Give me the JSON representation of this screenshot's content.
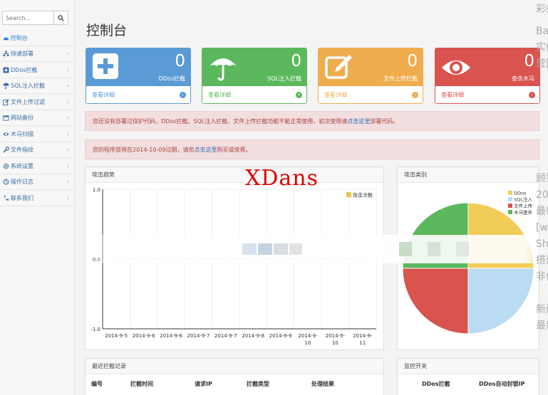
{
  "search": {
    "placeholder": "Search..."
  },
  "sidebar": {
    "items": [
      {
        "label": "控制台",
        "active": true
      },
      {
        "label": "快速部署",
        "chevron": "‹"
      },
      {
        "label": "DDos拦截",
        "chevron": "‹"
      },
      {
        "label": "SQL注入拦截",
        "chevron": "‹"
      },
      {
        "label": "文件上传过滤",
        "chevron": "‹"
      },
      {
        "label": "网站备份",
        "chevron": "‹"
      },
      {
        "label": "木马扫描",
        "chevron": "‹"
      },
      {
        "label": "文件指纹",
        "chevron": "‹"
      },
      {
        "label": "系统设置",
        "chevron": "‹"
      },
      {
        "label": "操作日志",
        "chevron": "‹"
      },
      {
        "label": "联系我们",
        "chevron": "‹"
      }
    ]
  },
  "page": {
    "title": "控制台"
  },
  "cards": [
    {
      "count": "0",
      "label": "DDos拦截",
      "link": "查看详细",
      "arrow": "›",
      "color": "#5a9bd5",
      "icon": "plus-icon"
    },
    {
      "count": "0",
      "label": "SQL注入拦截",
      "link": "查看详细",
      "arrow": "+",
      "color": "#5cb85c",
      "icon": "umbrella-icon"
    },
    {
      "count": "0",
      "label": "文件上传拦截",
      "link": "查看详细",
      "arrow": "›",
      "color": "#f0ad4e",
      "icon": "edit-icon"
    },
    {
      "count": "0",
      "label": "查杀木马",
      "link": "查看详细",
      "arrow": "›",
      "color": "#d9534f",
      "icon": "eye-icon"
    }
  ],
  "alerts": {
    "first_prefix": "您还没有部署过保护代码，DDos拦截、SQL注入拦截、文件上传拦截功能不能正常使用，初次使用请",
    "first_link": "点击这里",
    "first_suffix": "部署代码。",
    "second_prefix": "您的程序部将在2014-10-09过期，请您",
    "second_link": "点击这里",
    "second_suffix": "购买或续费。"
  },
  "watermark": "XDans",
  "right_clip": [
    "彩蚁",
    "Ba",
    "实们",
    "营回",
    "",
    "",
    "",
    "",
    "",
    "",
    "顾钰",
    "20",
    "最新",
    "[w",
    "Sh",
    "搭建",
    "非停",
    "",
    "新闻",
    "最新"
  ],
  "attack_trend": {
    "title": "攻击趋势",
    "legend": "攻击次数",
    "color": "#e8c34e"
  },
  "attack_types": {
    "title": "攻击类别",
    "legend": [
      {
        "name": "DDos",
        "color": "#f1cd58"
      },
      {
        "name": "SQL注入",
        "color": "#b9dcf3"
      },
      {
        "name": "文件上传",
        "color": "#d9534f"
      },
      {
        "name": "木马查杀",
        "color": "#5cb85c"
      }
    ]
  },
  "recent_log": {
    "title": "最近拦截记录",
    "columns": [
      "编号",
      "拦截时间",
      "请求IP",
      "拦截类型",
      "处理结果"
    ]
  },
  "monitor": {
    "title": "监控开关",
    "columns": [
      "DDos拦截",
      "DDos自动封锁IP"
    ]
  },
  "chart_data": [
    {
      "type": "line",
      "title": "攻击趋势",
      "x": [
        "2014-9-5",
        "2014-9-6",
        "2014-9-6",
        "2014-9-7",
        "2014-9-7",
        "2014-9-8",
        "2014-9-9",
        "2014-9-10",
        "2014-9-10",
        "2014-9-11"
      ],
      "series": [
        {
          "name": "攻击次数",
          "values": [
            0,
            0,
            0,
            0,
            0,
            0,
            0,
            0,
            0,
            0
          ]
        }
      ],
      "ylim": [
        -1.0,
        1.0
      ],
      "yticks": [
        "1.0",
        "0.0",
        "-1.0"
      ],
      "xlabel": "",
      "ylabel": "",
      "grid": true,
      "legend": "top-right"
    },
    {
      "type": "pie",
      "title": "攻击类别",
      "labels": [
        "DDos",
        "SQL注入",
        "文件上传",
        "木马查杀"
      ],
      "values": [
        25,
        25,
        25,
        25
      ],
      "legend": "top-left"
    }
  ]
}
